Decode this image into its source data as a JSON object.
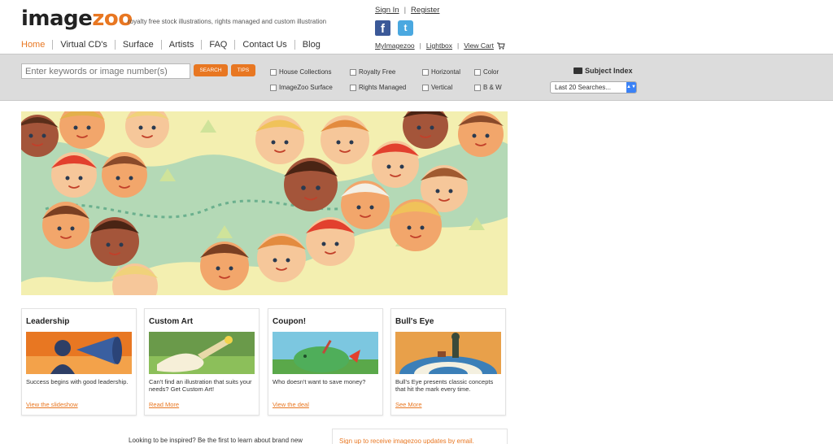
{
  "header": {
    "logo_part1": "image",
    "logo_part2": "zoo",
    "tagline": "royalty free stock illustrations, rights managed and custom illustration",
    "nav": [
      "Home",
      "Virtual CD's",
      "Surface",
      "Artists",
      "FAQ",
      "Contact Us",
      "Blog"
    ],
    "sign_in": "Sign In",
    "register": "Register",
    "sep": "|",
    "facebook_glyph": "f",
    "twitter_glyph": "t",
    "my_imagezoo": "MyImagezoo",
    "lightbox": "Lightbox",
    "view_cart": "View Cart"
  },
  "search": {
    "placeholder": "Enter keywords or image number(s)",
    "search_label": "SEARCH",
    "tips_label": "TIPS",
    "filters": {
      "house_collections": "House Collections",
      "royalty_free": "Royalty Free",
      "horizontal": "Horizontal",
      "color": "Color",
      "imagezoo_surface": "ImageZoo Surface",
      "rights_managed": "Rights Managed",
      "vertical": "Vertical",
      "bw": "B & W"
    },
    "subject_index": "Subject Index",
    "recent_searches": "Last 20 Searches..."
  },
  "cards": [
    {
      "title": "Leadership",
      "text": "Success begins with good leadership.",
      "link": "View the slideshow"
    },
    {
      "title": "Custom Art",
      "text": "Can't find an illustration that suits your needs? Get Custom Art!",
      "link": "Read More"
    },
    {
      "title": "Coupon!",
      "text": "Who doesn't want to save money?",
      "link": "View the deal"
    },
    {
      "title": "Bull's Eye",
      "text": "Bull's Eye presents classic concepts that hit the mark every time.",
      "link": "See More"
    }
  ],
  "footer": {
    "inspire": "Looking to be inspired? Be the first to learn about brand new",
    "signup": "Sign up to receive imagezoo updates by email."
  },
  "colors": {
    "accent": "#e87722",
    "facebook": "#3b5998",
    "twitter": "#4aa8e0",
    "bar": "#dcdcdc"
  }
}
